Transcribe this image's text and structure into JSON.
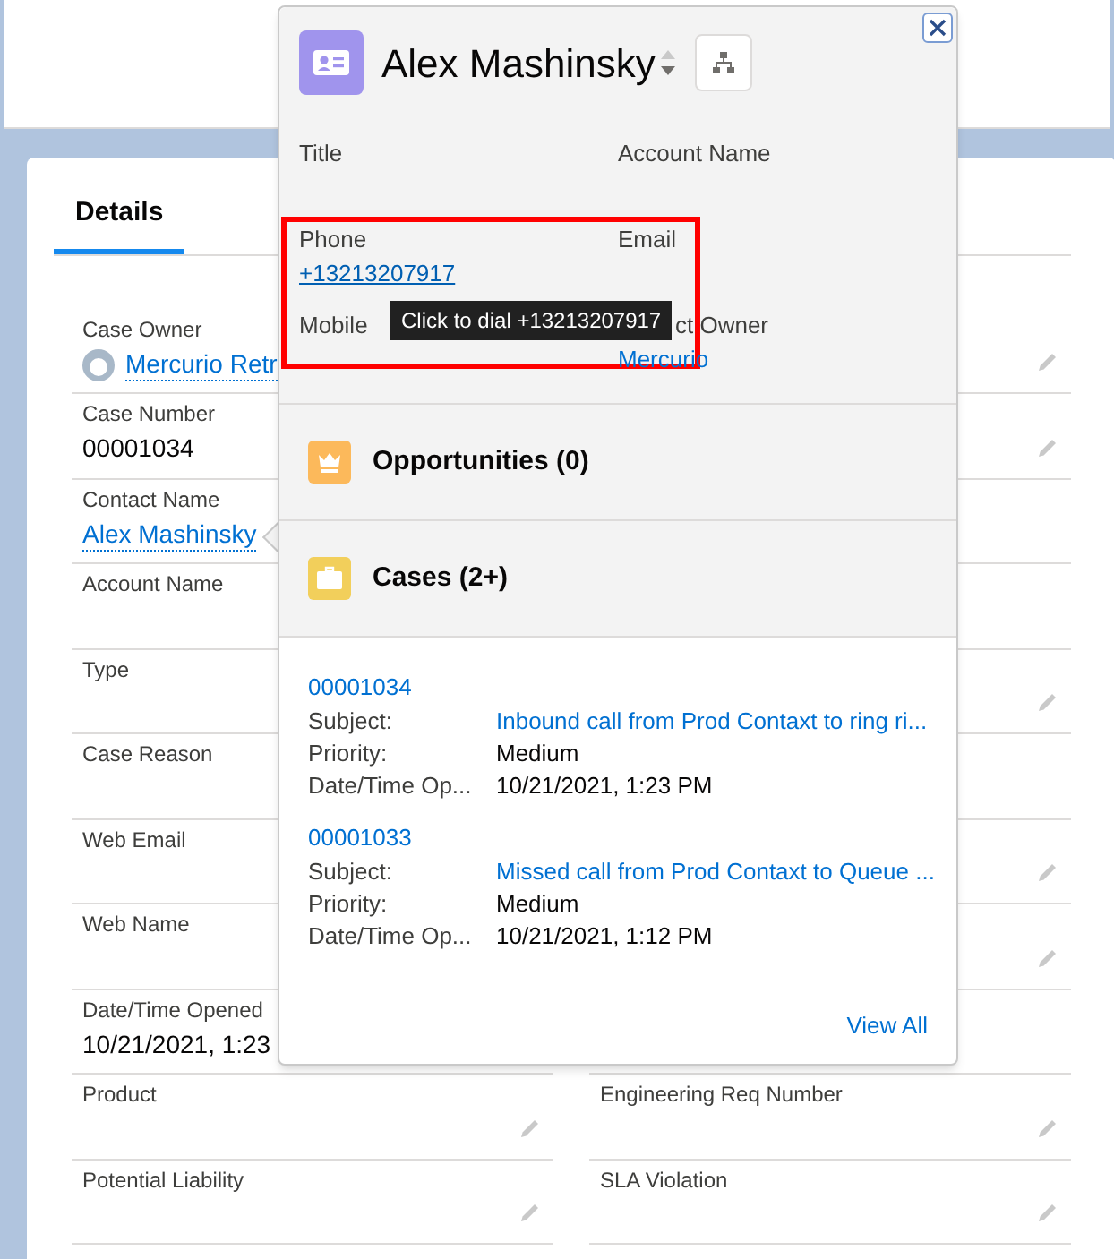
{
  "tabs": [
    {
      "label": "Details",
      "selected": true
    }
  ],
  "fields": {
    "left": [
      {
        "label": "Case Owner",
        "value": "Mercurio Retr",
        "kind": "user_link"
      },
      {
        "label": "Case Number",
        "value": "00001034",
        "kind": "text"
      },
      {
        "label": "Contact Name",
        "value": "Alex Mashinsky",
        "kind": "link"
      },
      {
        "label": "Account Name"
      },
      {
        "label": "Type"
      },
      {
        "label": "Case Reason"
      },
      {
        "label": "Web Email"
      },
      {
        "label": "Web Name"
      },
      {
        "label": "Date/Time Opened",
        "value": "10/21/2021, 1:23",
        "kind": "text"
      },
      {
        "label": "Product",
        "editable": true
      },
      {
        "label": "Potential Liability",
        "editable": true
      }
    ],
    "right": [
      {
        "editable": true
      },
      {
        "editable": true
      },
      {
        "editable": false
      },
      {
        "editable": false
      },
      {
        "editable": true
      },
      {
        "editable": false
      },
      {
        "editable": true
      },
      {
        "editable": true
      },
      {
        "editable": false
      },
      {
        "label": "Engineering Req Number",
        "editable": true
      },
      {
        "label": "SLA Violation",
        "editable": true
      }
    ]
  },
  "popover": {
    "name": "Alex Mashinsky",
    "fields": [
      {
        "label": "Title"
      },
      {
        "label": "Account Name"
      },
      {
        "label": "Phone",
        "value": "+13213207917",
        "kind": "link"
      },
      {
        "label": "Email"
      },
      {
        "label": "Mobile"
      },
      {
        "label": "ct Owner",
        "value": "Mercurio",
        "kind": "link"
      }
    ],
    "tooltip": "Click to dial +13213207917",
    "sections": [
      {
        "title": "Opportunities (0)",
        "kind": "opportunities"
      },
      {
        "title": "Cases (2+)",
        "kind": "cases"
      }
    ],
    "cases": [
      {
        "number": "00001034",
        "rows": [
          {
            "label": "Subject:",
            "value": "Inbound call from Prod Contaxt to ring ri...",
            "kind": "link"
          },
          {
            "label": "Priority:",
            "value": "Medium",
            "kind": "text"
          },
          {
            "label": "Date/Time Op...",
            "value": "10/21/2021, 1:23 PM",
            "kind": "text"
          }
        ]
      },
      {
        "number": "00001033",
        "rows": [
          {
            "label": "Subject:",
            "value": "Missed call from Prod Contaxt to Queue ...",
            "kind": "link"
          },
          {
            "label": "Priority:",
            "value": "Medium",
            "kind": "text"
          },
          {
            "label": "Date/Time Op...",
            "value": "10/21/2021, 1:12 PM",
            "kind": "text"
          }
        ]
      }
    ],
    "view_all": "View All"
  }
}
